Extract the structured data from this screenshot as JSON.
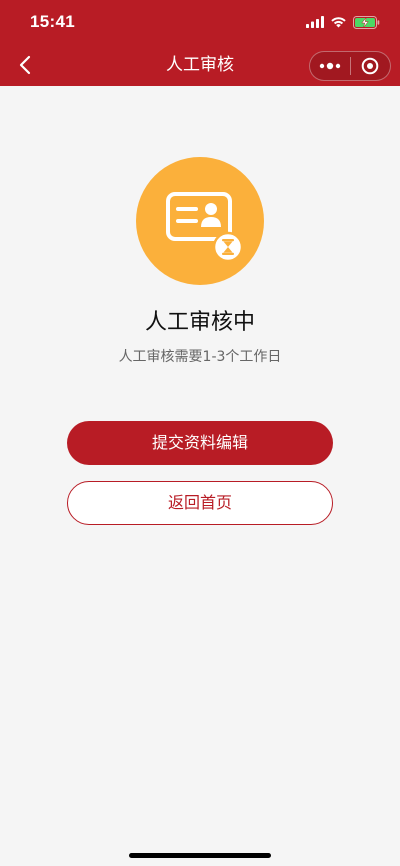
{
  "status_bar": {
    "time": "15:41",
    "signal_icon": "cellular-signal-icon",
    "wifi_icon": "wifi-icon",
    "battery_icon": "battery-charging-icon"
  },
  "nav": {
    "title": "人工审核",
    "back_icon": "chevron-left-icon",
    "more_icon": "more-dots-icon",
    "close_icon": "target-close-icon"
  },
  "result": {
    "illustration_icon": "id-card-hourglass-icon",
    "title": "人工审核中",
    "subtitle": "人工审核需要1-3个工作日"
  },
  "actions": {
    "primary_label": "提交资料编辑",
    "secondary_label": "返回首页"
  },
  "colors": {
    "brand": "#b81c25",
    "illustration_bg": "#fbb03b",
    "page_bg": "#f5f5f5"
  }
}
